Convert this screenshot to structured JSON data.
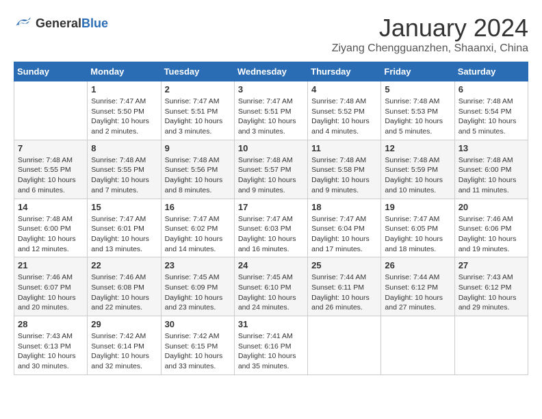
{
  "logo": {
    "text_general": "General",
    "text_blue": "Blue"
  },
  "title": "January 2024",
  "location": "Ziyang Chengguanzhen, Shaanxi, China",
  "days_of_week": [
    "Sunday",
    "Monday",
    "Tuesday",
    "Wednesday",
    "Thursday",
    "Friday",
    "Saturday"
  ],
  "weeks": [
    [
      {
        "day": "",
        "info": ""
      },
      {
        "day": "1",
        "info": "Sunrise: 7:47 AM\nSunset: 5:50 PM\nDaylight: 10 hours\nand 2 minutes."
      },
      {
        "day": "2",
        "info": "Sunrise: 7:47 AM\nSunset: 5:51 PM\nDaylight: 10 hours\nand 3 minutes."
      },
      {
        "day": "3",
        "info": "Sunrise: 7:47 AM\nSunset: 5:51 PM\nDaylight: 10 hours\nand 3 minutes."
      },
      {
        "day": "4",
        "info": "Sunrise: 7:48 AM\nSunset: 5:52 PM\nDaylight: 10 hours\nand 4 minutes."
      },
      {
        "day": "5",
        "info": "Sunrise: 7:48 AM\nSunset: 5:53 PM\nDaylight: 10 hours\nand 5 minutes."
      },
      {
        "day": "6",
        "info": "Sunrise: 7:48 AM\nSunset: 5:54 PM\nDaylight: 10 hours\nand 5 minutes."
      }
    ],
    [
      {
        "day": "7",
        "info": "Sunrise: 7:48 AM\nSunset: 5:55 PM\nDaylight: 10 hours\nand 6 minutes."
      },
      {
        "day": "8",
        "info": "Sunrise: 7:48 AM\nSunset: 5:55 PM\nDaylight: 10 hours\nand 7 minutes."
      },
      {
        "day": "9",
        "info": "Sunrise: 7:48 AM\nSunset: 5:56 PM\nDaylight: 10 hours\nand 8 minutes."
      },
      {
        "day": "10",
        "info": "Sunrise: 7:48 AM\nSunset: 5:57 PM\nDaylight: 10 hours\nand 9 minutes."
      },
      {
        "day": "11",
        "info": "Sunrise: 7:48 AM\nSunset: 5:58 PM\nDaylight: 10 hours\nand 9 minutes."
      },
      {
        "day": "12",
        "info": "Sunrise: 7:48 AM\nSunset: 5:59 PM\nDaylight: 10 hours\nand 10 minutes."
      },
      {
        "day": "13",
        "info": "Sunrise: 7:48 AM\nSunset: 6:00 PM\nDaylight: 10 hours\nand 11 minutes."
      }
    ],
    [
      {
        "day": "14",
        "info": "Sunrise: 7:48 AM\nSunset: 6:00 PM\nDaylight: 10 hours\nand 12 minutes."
      },
      {
        "day": "15",
        "info": "Sunrise: 7:47 AM\nSunset: 6:01 PM\nDaylight: 10 hours\nand 13 minutes."
      },
      {
        "day": "16",
        "info": "Sunrise: 7:47 AM\nSunset: 6:02 PM\nDaylight: 10 hours\nand 14 minutes."
      },
      {
        "day": "17",
        "info": "Sunrise: 7:47 AM\nSunset: 6:03 PM\nDaylight: 10 hours\nand 16 minutes."
      },
      {
        "day": "18",
        "info": "Sunrise: 7:47 AM\nSunset: 6:04 PM\nDaylight: 10 hours\nand 17 minutes."
      },
      {
        "day": "19",
        "info": "Sunrise: 7:47 AM\nSunset: 6:05 PM\nDaylight: 10 hours\nand 18 minutes."
      },
      {
        "day": "20",
        "info": "Sunrise: 7:46 AM\nSunset: 6:06 PM\nDaylight: 10 hours\nand 19 minutes."
      }
    ],
    [
      {
        "day": "21",
        "info": "Sunrise: 7:46 AM\nSunset: 6:07 PM\nDaylight: 10 hours\nand 20 minutes."
      },
      {
        "day": "22",
        "info": "Sunrise: 7:46 AM\nSunset: 6:08 PM\nDaylight: 10 hours\nand 22 minutes."
      },
      {
        "day": "23",
        "info": "Sunrise: 7:45 AM\nSunset: 6:09 PM\nDaylight: 10 hours\nand 23 minutes."
      },
      {
        "day": "24",
        "info": "Sunrise: 7:45 AM\nSunset: 6:10 PM\nDaylight: 10 hours\nand 24 minutes."
      },
      {
        "day": "25",
        "info": "Sunrise: 7:44 AM\nSunset: 6:11 PM\nDaylight: 10 hours\nand 26 minutes."
      },
      {
        "day": "26",
        "info": "Sunrise: 7:44 AM\nSunset: 6:12 PM\nDaylight: 10 hours\nand 27 minutes."
      },
      {
        "day": "27",
        "info": "Sunrise: 7:43 AM\nSunset: 6:12 PM\nDaylight: 10 hours\nand 29 minutes."
      }
    ],
    [
      {
        "day": "28",
        "info": "Sunrise: 7:43 AM\nSunset: 6:13 PM\nDaylight: 10 hours\nand 30 minutes."
      },
      {
        "day": "29",
        "info": "Sunrise: 7:42 AM\nSunset: 6:14 PM\nDaylight: 10 hours\nand 32 minutes."
      },
      {
        "day": "30",
        "info": "Sunrise: 7:42 AM\nSunset: 6:15 PM\nDaylight: 10 hours\nand 33 minutes."
      },
      {
        "day": "31",
        "info": "Sunrise: 7:41 AM\nSunset: 6:16 PM\nDaylight: 10 hours\nand 35 minutes."
      },
      {
        "day": "",
        "info": ""
      },
      {
        "day": "",
        "info": ""
      },
      {
        "day": "",
        "info": ""
      }
    ]
  ]
}
